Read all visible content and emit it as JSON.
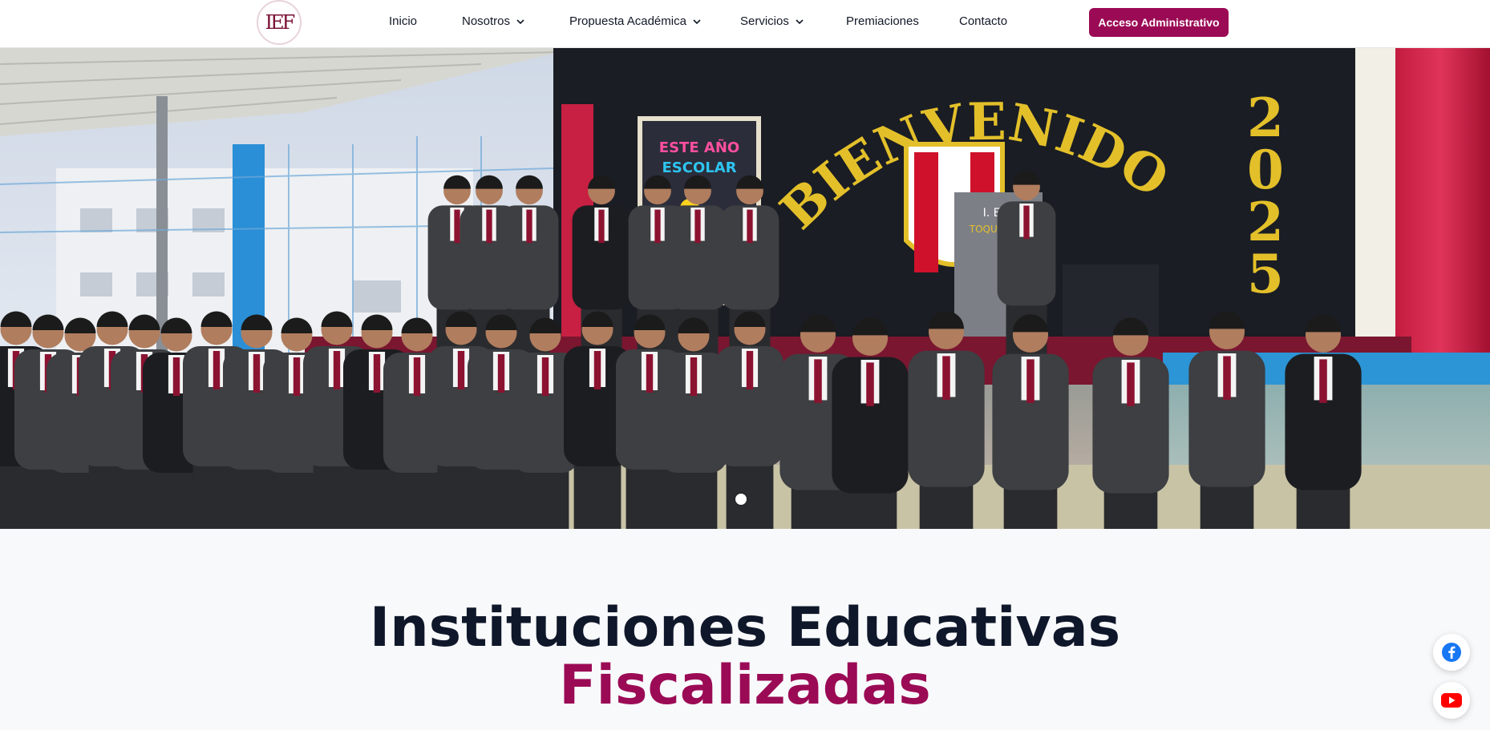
{
  "nav": {
    "logo_text": "IEF",
    "items": [
      {
        "label": "Inicio",
        "has_dropdown": false
      },
      {
        "label": "Nosotros",
        "has_dropdown": true
      },
      {
        "label": "Propuesta Académica",
        "has_dropdown": true
      },
      {
        "label": "Servicios",
        "has_dropdown": true
      },
      {
        "label": "Premiaciones",
        "has_dropdown": false
      },
      {
        "label": "Contacto",
        "has_dropdown": false
      }
    ],
    "admin_button": "Acceso Administrativo"
  },
  "hero": {
    "banner_text": "BIENVENIDOS",
    "year_text": "2025",
    "sign_text": "ESTE AÑO ESCOLAR",
    "podium_text": "I. E. F TOQUEPALA",
    "slide_count": 1,
    "active_slide": 1
  },
  "intro": {
    "title_line1": "Instituciones Educativas",
    "title_line2": "Fiscalizadas"
  },
  "social": [
    {
      "name": "facebook",
      "icon": "facebook-icon"
    },
    {
      "name": "youtube",
      "icon": "youtube-icon"
    }
  ],
  "colors": {
    "brand": "#9b0a55",
    "heading_dark": "#0f172a",
    "facebook": "#1877f2",
    "youtube": "#ff0000"
  }
}
